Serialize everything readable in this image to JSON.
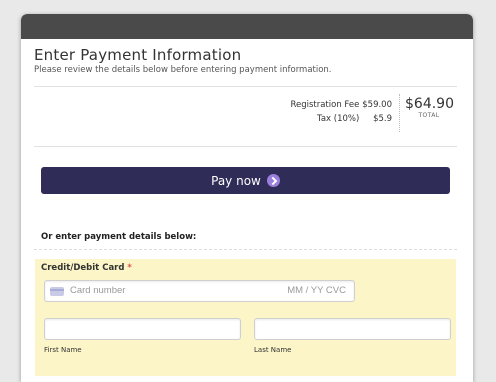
{
  "form": {
    "heading": "Enter Payment Information",
    "subheading": "Please review the details below before entering payment information."
  },
  "fees": {
    "registration_label": "Registration Fee",
    "registration_amount": "$59.00",
    "tax_label": "Tax (10%)",
    "tax_amount": "$5.9",
    "total_amount": "$64.90",
    "total_label": "TOTAL"
  },
  "pay_button": {
    "label": "Pay now",
    "color": "#2f2c58",
    "icon": "chevron-right-icon"
  },
  "alt_text": "Or enter payment details below:",
  "card": {
    "label": "Credit/Debit Card",
    "required_mark": "*",
    "number_placeholder": "Card number",
    "expiry_cvc_placeholder": "MM / YY  CVC",
    "icon": "credit-card-icon"
  },
  "name": {
    "first_label": "First Name",
    "last_label": "Last Name",
    "first_value": "",
    "last_value": ""
  },
  "colors": {
    "titlebar": "#4a4a4a",
    "card_panel": "#fbf5c8",
    "required": "#d9534f"
  }
}
